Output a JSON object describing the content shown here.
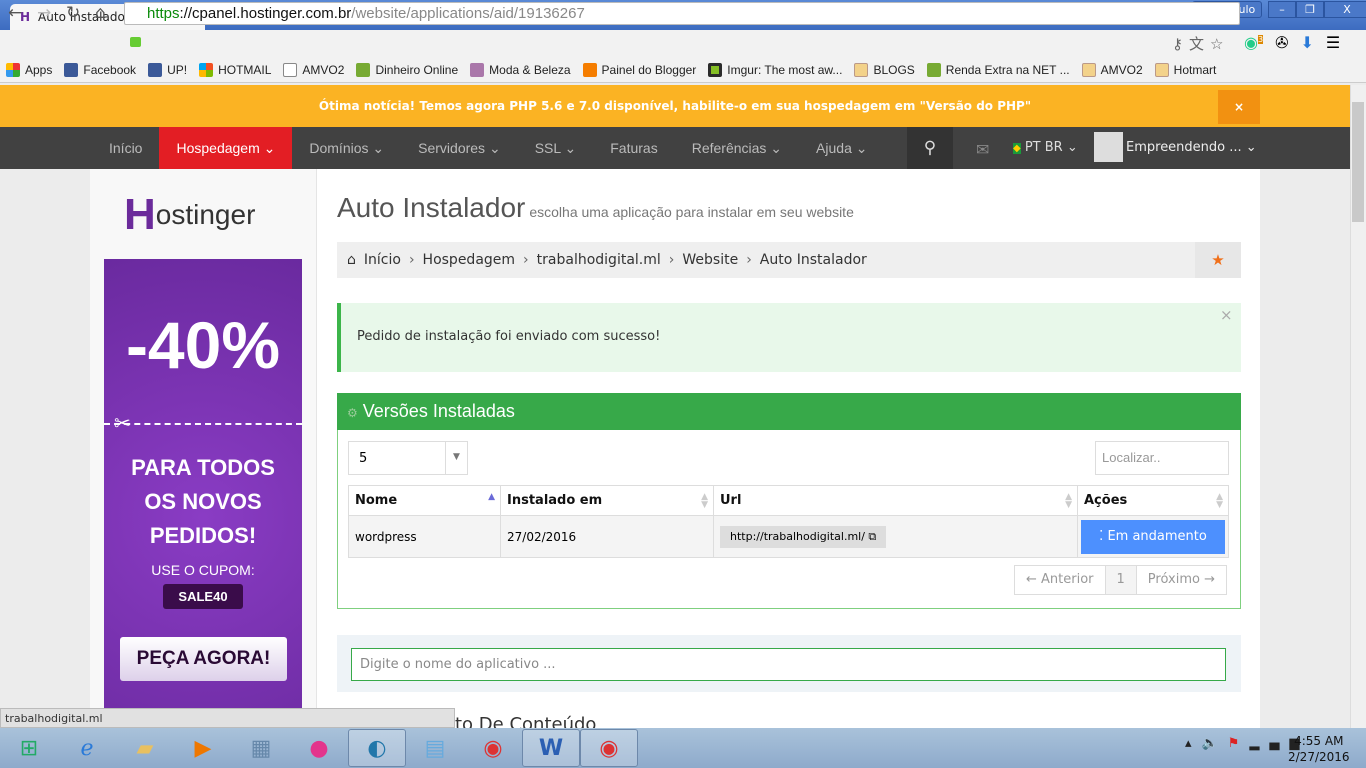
{
  "browser": {
    "tab_title": "Auto Instalador",
    "user": "João Paulo",
    "url_scheme": "https",
    "url_host": "://cpanel.hostinger.com.br",
    "url_path": "/website/applications/aid/19136267",
    "ext_badge": "3"
  },
  "bookmarks": [
    "Apps",
    "Facebook",
    "UP!",
    "HOTMAIL",
    "AMVO2",
    "Dinheiro Online",
    "Moda & Beleza",
    "Painel do Blogger",
    "Imgur: The most aw...",
    "BLOGS",
    "Renda Extra na NET ...",
    "AMVO2",
    "Hotmart"
  ],
  "banner": {
    "text": "Ótima notícia! Temos agora PHP 5.6 e 7.0 disponível, habilite-o em sua hospedagem em \"Versão do PHP\"",
    "close": "×"
  },
  "nav": {
    "items": [
      "Início",
      "Hospedagem ⌄",
      "Domínios ⌄",
      "Servidores ⌄",
      "SSL ⌄",
      "Faturas",
      "Referências ⌄",
      "Ajuda ⌄"
    ],
    "language": "PT BR ⌄",
    "account": "Empreendendo ...  ⌄"
  },
  "sidebar": {
    "logo": "ostinger",
    "ad": {
      "discount": "-40%",
      "line1": "PARA TODOS",
      "line2": "OS NOVOS",
      "line3": "PEDIDOS!",
      "coupon_label": "USE O CUPOM:",
      "coupon": "SALE40",
      "cta": "PEÇA AGORA!"
    }
  },
  "main": {
    "title": "Auto Instalador",
    "subtitle": "escolha uma aplicação para instalar em seu website",
    "breadcrumb": [
      "Início",
      "Hospedagem",
      "trabalhodigital.ml",
      "Website",
      "Auto Instalador"
    ],
    "alert": "Pedido de instalação foi enviado com sucesso!",
    "panel": {
      "title": "Versões Instaladas",
      "page_length": "5",
      "search_placeholder": "Localizar..",
      "columns": [
        "Nome",
        "Instalado em",
        "Url",
        "Ações"
      ],
      "rows": [
        {
          "name": "wordpress",
          "installed": "27/02/2016",
          "url": "http://trabalhodigital.ml/",
          "action": "Em andamento"
        }
      ],
      "pager": {
        "prev": "← Anterior",
        "page": "1",
        "next": "Próximo →"
      }
    },
    "app_search_placeholder": "Digite o nome do aplicativo ...",
    "section_heading_partial": "to De Conteúdo"
  },
  "status_bar": "trabalhodigital.ml",
  "taskbar": {
    "time": "4:55 AM",
    "date": "2/27/2016"
  },
  "colors": {
    "banner": "#fbb323",
    "nav_active": "#e31e24",
    "panel_green": "#37a949",
    "button_blue": "#4d90fe"
  }
}
